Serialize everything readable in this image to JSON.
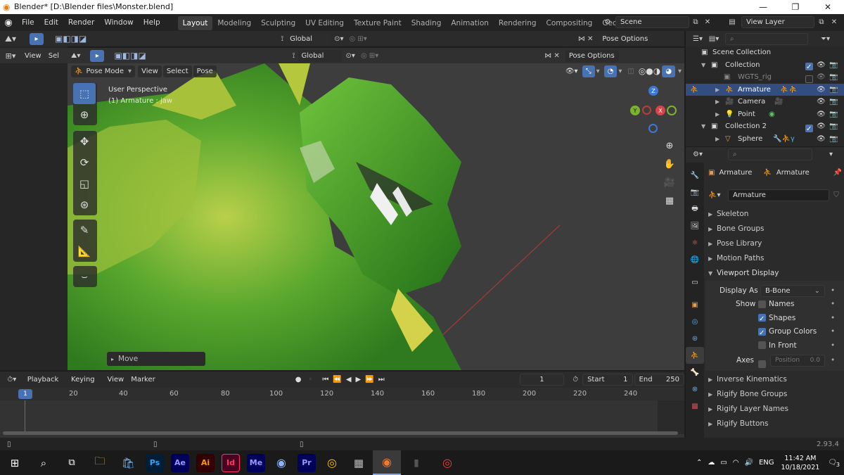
{
  "window": {
    "title": "Blender* [D:\\Blender files\\Monster.blend]",
    "minimize": "—",
    "maximize": "❐",
    "close": "✕"
  },
  "menu": [
    "File",
    "Edit",
    "Render",
    "Window",
    "Help"
  ],
  "workspaces": [
    "Layout",
    "Modeling",
    "Sculpting",
    "UV Editing",
    "Texture Paint",
    "Shading",
    "Animation",
    "Rendering",
    "Compositing",
    "Geometry Nod"
  ],
  "scene": "Scene",
  "view_layer": "View Layer",
  "header1": {
    "orientation": "Global",
    "pose_options": "Pose Options",
    "view": "View",
    "select": "Sel"
  },
  "header2": {
    "orientation": "Global",
    "pose_options": "Pose Options"
  },
  "viewport_header": {
    "mode": "Pose Mode",
    "view": "View",
    "select": "Select",
    "pose": "Pose"
  },
  "viewport": {
    "perspective": "User Perspective",
    "object": "(1) Armature : jaw",
    "last_op": "Move",
    "gizmo": {
      "z": "Z",
      "y": "Y",
      "x": "X"
    }
  },
  "outliner": {
    "scene_collection": "Scene Collection",
    "rows": [
      {
        "label": "Collection"
      },
      {
        "label": "WGTS_rig"
      },
      {
        "label": "Armature"
      },
      {
        "label": "Camera"
      },
      {
        "label": "Point"
      },
      {
        "label": "Collection 2"
      },
      {
        "label": "Sphere"
      }
    ]
  },
  "properties": {
    "breadcrumb_a": "Armature",
    "breadcrumb_b": "Armature",
    "data_name": "Armature",
    "panels_top": [
      "Skeleton",
      "Bone Groups",
      "Pose Library",
      "Motion Paths"
    ],
    "viewport_display": "Viewport Display",
    "display_as_label": "Display As",
    "display_as_value": "B-Bone",
    "show_label": "Show",
    "show_options": [
      {
        "label": "Names",
        "checked": false
      },
      {
        "label": "Shapes",
        "checked": true
      },
      {
        "label": "Group Colors",
        "checked": true
      },
      {
        "label": "In Front",
        "checked": false
      }
    ],
    "axes_label": "Axes",
    "position_label": "Position",
    "position_value": "0.0",
    "panels_bottom": [
      "Inverse Kinematics",
      "Rigify Bone Groups",
      "Rigify Layer Names",
      "Rigify Buttons"
    ]
  },
  "timeline": {
    "playback": "Playback",
    "keying": "Keying",
    "view": "View",
    "marker": "Marker",
    "current_frame": "1",
    "start_label": "Start",
    "start": "1",
    "end_label": "End",
    "end": "250",
    "ruler": [
      "1",
      "20",
      "40",
      "60",
      "80",
      "100",
      "120",
      "140",
      "160",
      "180",
      "200",
      "220",
      "240"
    ]
  },
  "status": {
    "version": "2.93.4"
  },
  "taskbar": {
    "apps": [
      {
        "name": "Ps",
        "color": "#31a8ff",
        "bg": "#001e36"
      },
      {
        "name": "Ae",
        "color": "#9999ff",
        "bg": "#00005b"
      },
      {
        "name": "Ai",
        "color": "#ff9a00",
        "bg": "#330000"
      },
      {
        "name": "Id",
        "color": "#ff3366",
        "bg": "#49021f"
      },
      {
        "name": "Me",
        "color": "#9999ff",
        "bg": "#00005b"
      },
      {
        "name": "Pr",
        "color": "#9999ff",
        "bg": "#00005b"
      }
    ],
    "lang": "ENG",
    "time": "11:42 AM",
    "date": "10/18/2021",
    "notifications": "3"
  },
  "colors": {
    "accent": "#4772b3",
    "bg": "#1d1d1d",
    "header": "#2b2b2b",
    "viewport": "#3d3d3d"
  }
}
